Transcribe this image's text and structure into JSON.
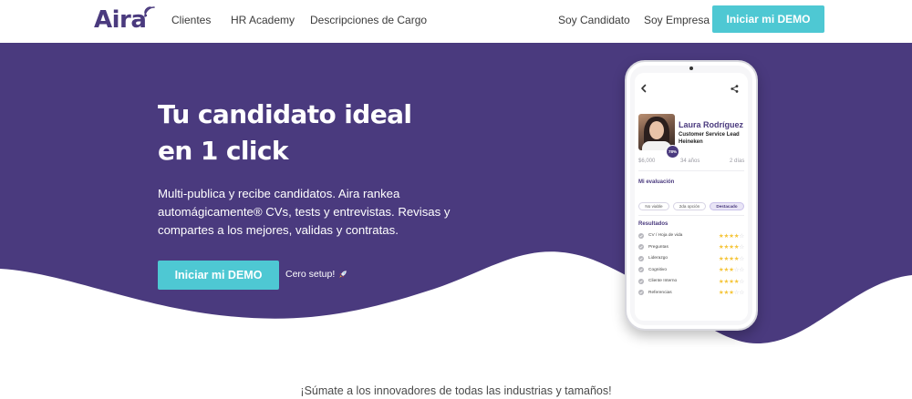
{
  "brand": {
    "name": "Aira",
    "primary_color": "#4a3a7e",
    "accent_color": "#4ec8d3",
    "icon": "wifi-signal-icon"
  },
  "nav": {
    "links": [
      "Clientes",
      "HR Academy",
      "Descripciones de Cargo"
    ],
    "right_links": [
      "Soy Candidato",
      "Soy Empresa"
    ],
    "cta": "Iniciar mi DEMO"
  },
  "hero": {
    "title_line1": "Tu candidato ideal",
    "title_line2": "en 1 click",
    "description": "Multi-publica y recibe candidatos. Aira rankea automágicamente® CVs, tests y entrevistas. Revisas y compartes a los mejores, validas y contratas.",
    "cta": "Iniciar mi DEMO",
    "setup_note": "Cero setup!",
    "setup_icon": "rocket-icon",
    "background_color": "#4a3a7e"
  },
  "phone": {
    "candidate": {
      "name": "Laura Rodríguez",
      "role": "Customer Service Lead",
      "company": "Heineken",
      "match": "78%",
      "salary": "$6,000",
      "age": "34 años",
      "availability": "2 días"
    },
    "evaluation": {
      "title": "Mi evaluación",
      "options": [
        "No viable",
        "2da opción",
        "Destacado"
      ],
      "selected": "Destacado"
    },
    "results": {
      "title": "Resultados",
      "items": [
        {
          "label": "CV / Hoja de vida",
          "stars": 4
        },
        {
          "label": "Preguntas",
          "stars": 4
        },
        {
          "label": "Liderazgo",
          "stars": 4
        },
        {
          "label": "Cognitivo",
          "stars": 3
        },
        {
          "label": "Cliente Interno",
          "stars": 4
        },
        {
          "label": "Referencias",
          "stars": 3
        }
      ],
      "max_stars": 5
    }
  },
  "bottom": {
    "tagline": "¡Súmate a los innovadores de todas las industrias y tamaños!"
  }
}
